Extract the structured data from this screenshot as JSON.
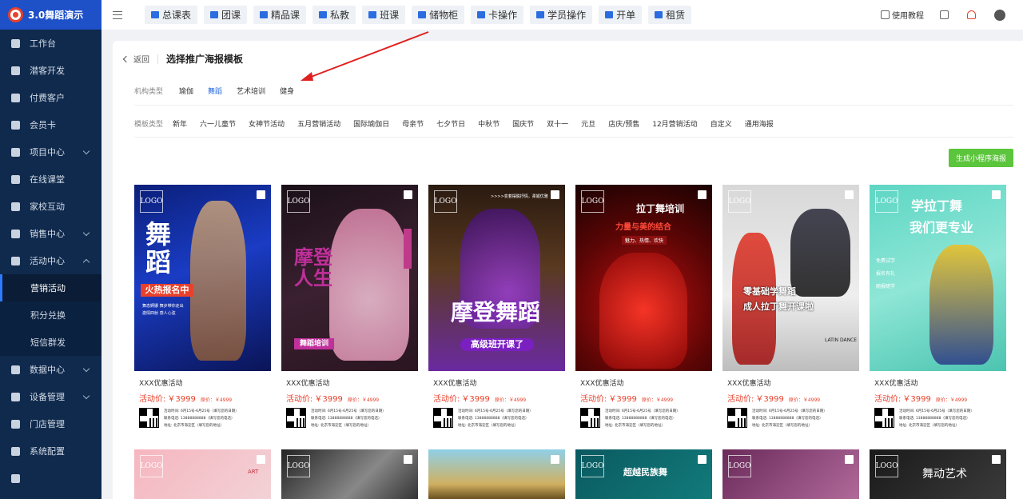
{
  "app": {
    "brand": "3.0舞蹈演示"
  },
  "sidebar": {
    "items": [
      {
        "label": "工作台"
      },
      {
        "label": "潜客开发"
      },
      {
        "label": "付费客户"
      },
      {
        "label": "会员卡"
      },
      {
        "label": "项目中心"
      },
      {
        "label": "在线课堂"
      },
      {
        "label": "家校互动"
      },
      {
        "label": "销售中心"
      },
      {
        "label": "活动中心"
      },
      {
        "label": "数据中心"
      },
      {
        "label": "设备管理"
      },
      {
        "label": "门店管理"
      },
      {
        "label": "系统配置"
      }
    ],
    "sub_items": [
      {
        "label": "营销活动"
      },
      {
        "label": "积分兑换"
      },
      {
        "label": "短信群发"
      }
    ]
  },
  "topbar": {
    "tabs": [
      {
        "label": "总课表"
      },
      {
        "label": "团课"
      },
      {
        "label": "精品课"
      },
      {
        "label": "私教"
      },
      {
        "label": "班课"
      },
      {
        "label": "储物柜"
      },
      {
        "label": "卡操作"
      },
      {
        "label": "学员操作"
      },
      {
        "label": "开单"
      },
      {
        "label": "租赁"
      }
    ],
    "help_label": "使用教程"
  },
  "page": {
    "back_label": "返回",
    "title": "选择推广海报模板",
    "org_type_label": "机构类型",
    "org_types": [
      "瑜伽",
      "舞蹈",
      "艺术培训",
      "健身"
    ],
    "org_type_active": "舞蹈",
    "template_type_label": "模板类型",
    "template_types": [
      "新年",
      "六一儿童节",
      "女神节活动",
      "五月营销活动",
      "国际瑜伽日",
      "母亲节",
      "七夕节日",
      "中秋节",
      "国庆节",
      "双十一",
      "元旦",
      "店庆/预售",
      "12月营销活动",
      "自定义",
      "通用海报"
    ],
    "generate_button": "生成小程序海报"
  },
  "cards": [
    {
      "title": "XXX优惠活动",
      "price_label": "活动价:",
      "price": "￥3999",
      "orig": "原价：￥4999",
      "info": [
        "活动时间: 6月15号-6月25号（填写您的日期）",
        "联系电话: 13888888888（填写您的电话）",
        "地址: 北京市海淀区（填写您的地址）"
      ],
      "poster_logo": "LOGO",
      "poster_main": "舞蹈",
      "poster_ribbon": "火热报名中",
      "poster_sub": "舞态婀娜 舞步带你走出\n激情四射 感人心弦"
    },
    {
      "title": "XXX优惠活动",
      "price_label": "活动价:",
      "price": "￥3999",
      "orig": "原价：￥4999",
      "info": [
        "活动时间: 6月15号-6月25号（填写您的日期）",
        "联系电话: 13888888888（填写您的电话）",
        "地址: 北京市海淀区（填写您的地址）"
      ],
      "poster_logo": "LOGO",
      "poster_main": "摩登人生",
      "poster_ribbon": "舞蹈培训",
      "poster_sub": ""
    },
    {
      "title": "XXX优惠活动",
      "price_label": "活动价:",
      "price": "￥3999",
      "orig": "原价：￥4999",
      "info": [
        "活动时间: 6月15号-6月25号（填写您的日期）",
        "联系电话: 13888888888（填写您的电话）",
        "地址: 北京市海淀区（填写您的地址）"
      ],
      "poster_logo": "LOGO",
      "poster_main": "摩登舞蹈",
      "poster_ribbon": "高级班开课了",
      "poster_sub": ">>>>变着摆脱抒情，柔媚优雅"
    },
    {
      "title": "XXX优惠活动",
      "price_label": "活动价:",
      "price": "￥3999",
      "orig": "原价：￥4999",
      "info": [
        "活动时间: 6月15号-6月25号（填写您的日期）",
        "联系电话: 13888888888（填写您的电话）",
        "地址: 北京市海淀区（填写您的地址）"
      ],
      "poster_logo": "LOGO",
      "poster_main": "拉丁舞培训",
      "poster_ribbon": "力量与美的结合",
      "poster_sub": "魅力、热情、欢快"
    },
    {
      "title": "XXX优惠活动",
      "price_label": "活动价:",
      "price": "￥3999",
      "orig": "原价：￥4999",
      "info": [
        "活动时间: 6月15号-6月25号（填写您的日期）",
        "联系电话: 13888888888（填写您的电话）",
        "地址: 北京市海淀区（填写您的地址）"
      ],
      "poster_logo": "LOGO",
      "poster_main": "零基础学舞蹈",
      "poster_ribbon": "成人拉丁舞开课啦",
      "poster_sub": "LATIN DANCE"
    },
    {
      "title": "XXX优惠活动",
      "price_label": "活动价:",
      "price": "￥3999",
      "orig": "原价：￥4999",
      "info": [
        "活动时间: 6月15号-6月25号（填写您的日期）",
        "联系电话: 13888888888（填写您的电话）",
        "地址: 北京市海淀区（填写您的地址）"
      ],
      "poster_logo": "LOGO",
      "poster_main": "学拉丁舞",
      "poster_ribbon": "我们更专业",
      "poster_sub": "免费试学\n报名有礼\n随报随学"
    }
  ],
  "cards_row2": [
    {
      "poster_logo": "LOGO",
      "poster_text": "ART"
    },
    {
      "poster_logo": "LOGO",
      "poster_text": ""
    },
    {
      "poster_logo": "",
      "poster_text": ""
    },
    {
      "poster_logo": "LOGO",
      "poster_text": "超越民族舞"
    },
    {
      "poster_logo": "LOGO",
      "poster_text": ""
    },
    {
      "poster_logo": "LOGO",
      "poster_text": "舞动艺术"
    }
  ],
  "colors": {
    "sidebar_bg": "#0f2a4d",
    "brand_bg": "#1e50c8",
    "accent": "#2b6de0",
    "price_red": "#e8402b",
    "generate_green": "#5bc53b",
    "annotation_arrow": "#e02020"
  }
}
